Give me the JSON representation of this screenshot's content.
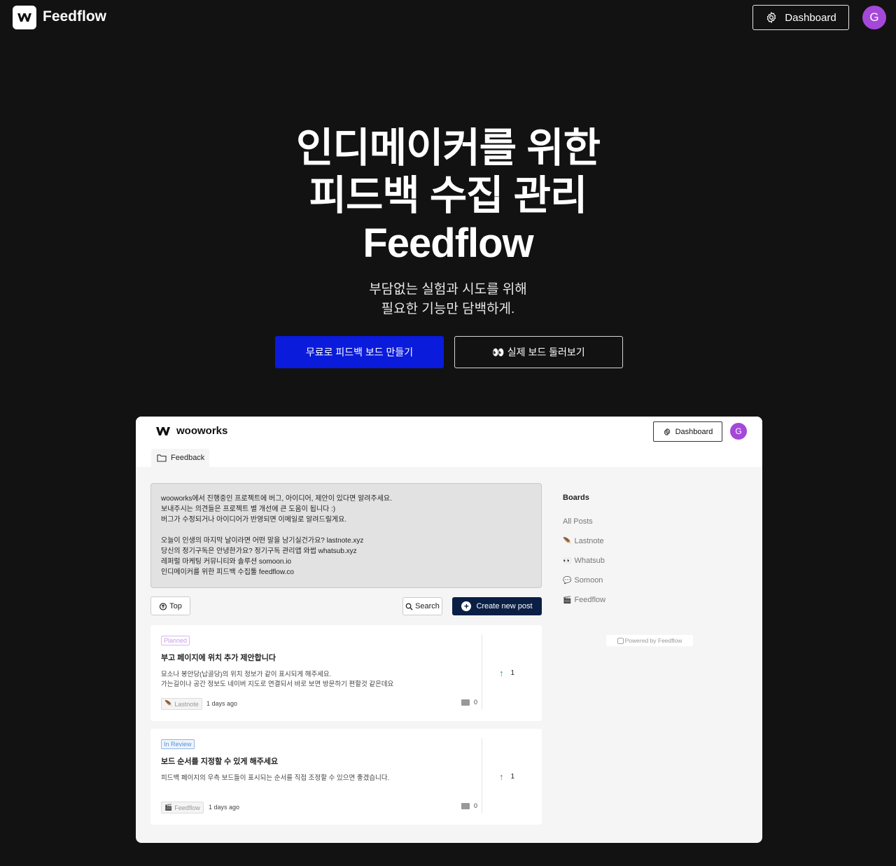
{
  "nav": {
    "brand": "Feedflow",
    "dashboard_label": "Dashboard",
    "avatar_initial": "G",
    "avatar_color": "#a548d9"
  },
  "hero": {
    "title_line1": "인디메이커를 위한",
    "title_line2": "피드백 수집 관리",
    "title_line3": "Feedflow",
    "sub_line1": "부담없는 실험과 시도를 위해",
    "sub_line2": "필요한 기능만 담백하게.",
    "cta_primary": "무료로 피드백 보드 만들기",
    "cta_secondary_emoji": "👀",
    "cta_secondary": "실제 보드 둘러보기",
    "primary_color": "#0a1bdb"
  },
  "preview": {
    "brand": "wooworks",
    "dashboard_label": "Dashboard",
    "avatar_initial": "G",
    "tab_label": "Feedback",
    "description": {
      "line1": "wooworks에서 진행중인 프로젝트에 버그, 아이디어, 제안이 있다면 알려주세요.",
      "line2": "보내주시는 의견들은 프로젝트 별 개선에 큰 도움이 됩니다 :)",
      "line3": "버그가 수정되거나 아이디어가 반영되면 이메일로 알려드릴게요.",
      "line4": "오늘이 인생의 마지막 날이라면 어떤 말을 남기실건가요? lastnote.xyz",
      "line5": "당신의 정기구독은 안녕한가요? 정기구독 관리앱 와썹 whatsub.xyz",
      "line6": "레퍼럴 마케팅 커뮤니티와 솔루션 somoon.io",
      "line7": "인디메이커를 위한 피드백 수집툴 feedflow.co"
    },
    "top_label": "Top",
    "search_label": "Search",
    "create_label": "Create new post",
    "posts": [
      {
        "status": "Planned",
        "title": "부고 페이지에 위치 추가 제안합니다",
        "body_line1": "묘소나 봉안당(납골당)의 위치 정보가 같이 표시되게 해주세요.",
        "body_line2": "가는길이나 공간 정보도 네이버 지도로 연결되서 바로 보면 방문하기 편할것 같은데요",
        "tag_emoji": "🪶",
        "tag": "Lastnote",
        "time": "1 days ago",
        "comments": "0",
        "votes": "1"
      },
      {
        "status": "In Review",
        "title": "보드 순서를 지정할 수 있게 해주세요",
        "body_line1": "피드백 페이지의 우측 보드들이 표시되는 순서를 직접 조정할 수 있으면 좋겠습니다.",
        "tag_emoji": "🎬",
        "tag": "Feedflow",
        "time": "1 days ago",
        "comments": "0",
        "votes": "1"
      }
    ],
    "boards_title": "Boards",
    "boards": [
      {
        "emoji": "",
        "label": "All Posts"
      },
      {
        "emoji": "🪶",
        "label": "Lastnote"
      },
      {
        "emoji": "👀",
        "label": "Whatsub"
      },
      {
        "emoji": "💬",
        "label": "Somoon"
      },
      {
        "emoji": "🎬",
        "label": "Feedflow"
      }
    ],
    "powered": "Powered by Feedflow"
  }
}
